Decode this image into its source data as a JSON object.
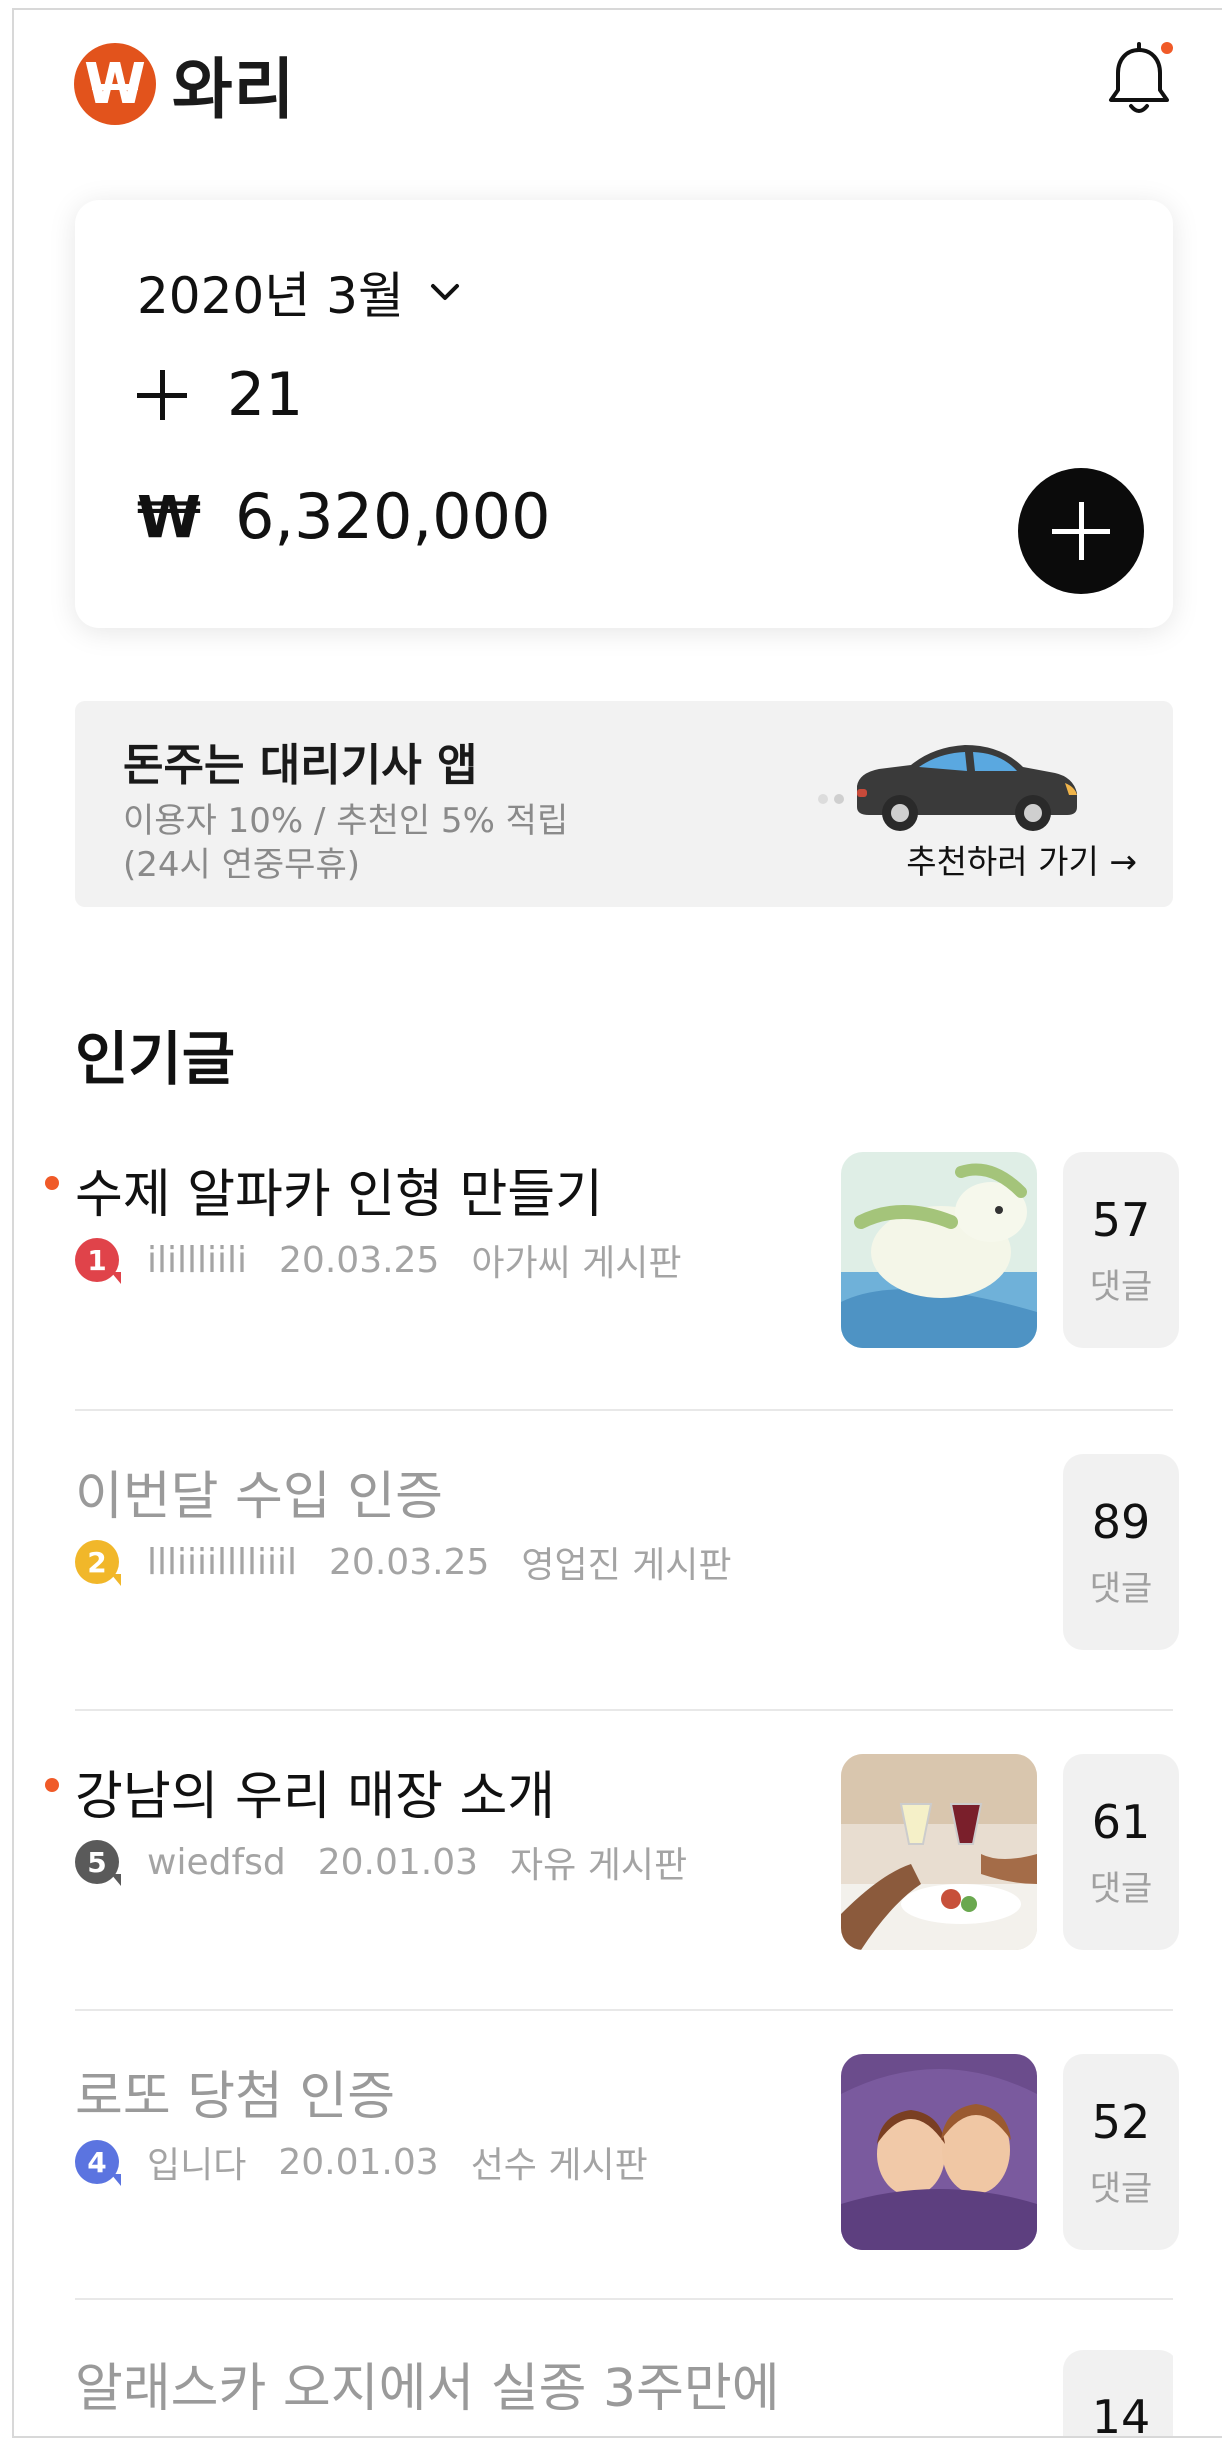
{
  "header": {
    "app_name": "와리",
    "logo_letter": "W",
    "notification_icon": "bell-icon",
    "has_notification": true
  },
  "summary": {
    "month": "2020년 3월",
    "count": "21",
    "currency_symbol": "₩",
    "amount": "6,320,000"
  },
  "banner": {
    "title": "돈주는 대리기사 앱",
    "subtitle": "이용자 10% / 추천인 5% 적립",
    "note": "(24시 연중무휴)",
    "link_text": "추천하러 가기 →"
  },
  "popular": {
    "title": "인기글",
    "comment_label": "댓글",
    "posts": [
      {
        "title": "수제 알파카 인형 만들기",
        "rank": "1",
        "author": "ilillliili",
        "date": "20.03.25",
        "board": "아가씨 게시판",
        "comments": "57",
        "unread": true,
        "rank_color": "#e0434a"
      },
      {
        "title": "이번달 수입 인증",
        "rank": "2",
        "author": "llliiiilllliiil",
        "date": "20.03.25",
        "board": "영업진 게시판",
        "comments": "89",
        "unread": false,
        "rank_color": "#f1b72a"
      },
      {
        "title": "강남의 우리 매장 소개",
        "rank": "5",
        "author": "wiedfsd",
        "date": "20.01.03",
        "board": "자유 게시판",
        "comments": "61",
        "unread": true,
        "rank_color": "#5a5a5a"
      },
      {
        "title": "로또 당첨 인증",
        "rank": "4",
        "author": "입니다",
        "date": "20.01.03",
        "board": "선수 게시판",
        "comments": "52",
        "unread": false,
        "rank_color": "#5b74e0"
      },
      {
        "title": "알래스카 오지에서 실종 3주만에",
        "comments": "14",
        "unread": false
      }
    ]
  },
  "colors": {
    "accent": "#f05a28",
    "logo": "#e2531c",
    "card_button": "#0b0b0b"
  }
}
